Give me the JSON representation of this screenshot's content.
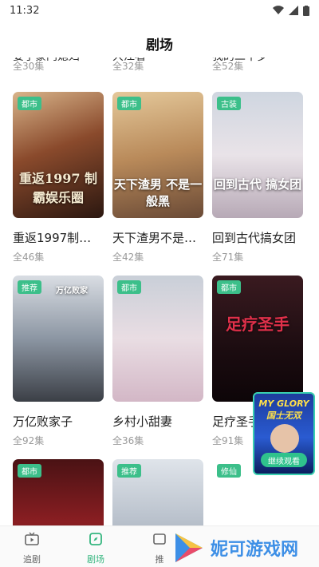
{
  "status_bar": {
    "time": "11:32"
  },
  "header": {
    "title": "剧场"
  },
  "cut_row": {
    "titles": [
      "娶了豪门媳妇",
      "大江看",
      "我的二十岁"
    ],
    "counts": [
      "全30集",
      "全32集",
      "全52集"
    ]
  },
  "dramas": [
    {
      "tag": "都市",
      "title": "重返1997制…",
      "count": "全46集",
      "poster_text": "重返1997 制霸娱乐圈"
    },
    {
      "tag": "都市",
      "title": "天下渣男不是…",
      "count": "全42集",
      "poster_text": "天下渣男 不是一般黑"
    },
    {
      "tag": "古装",
      "title": "回到古代搞女团",
      "count": "全71集",
      "poster_text": "回到古代 搞女团"
    },
    {
      "tag": "推荐",
      "title": "万亿败家子",
      "count": "全92集",
      "poster_text": "万亿败家"
    },
    {
      "tag": "都市",
      "title": "乡村小甜妻",
      "count": "全36集",
      "poster_text": ""
    },
    {
      "tag": "都市",
      "title": "足疗圣手",
      "count": "全91集",
      "poster_text": "足疗圣手"
    },
    {
      "tag": "都市",
      "title": "",
      "count": "",
      "poster_text": ""
    },
    {
      "tag": "推荐",
      "title": "",
      "count": "",
      "poster_text": ""
    },
    {
      "tag": "修仙",
      "title": "",
      "count": "",
      "poster_text": ""
    }
  ],
  "float_ad": {
    "title": "国士无双",
    "subtitle": "MY GLORY",
    "button": "继续观看"
  },
  "tabs": [
    {
      "label": "追剧",
      "icon": "tv-icon"
    },
    {
      "label": "剧场",
      "icon": "compass-icon"
    },
    {
      "label": "推",
      "icon": "recommend-icon"
    }
  ],
  "watermark": {
    "text": "妮可游戏网"
  },
  "colors": {
    "accent": "#35b67f",
    "tag": "#3cbf8a"
  }
}
